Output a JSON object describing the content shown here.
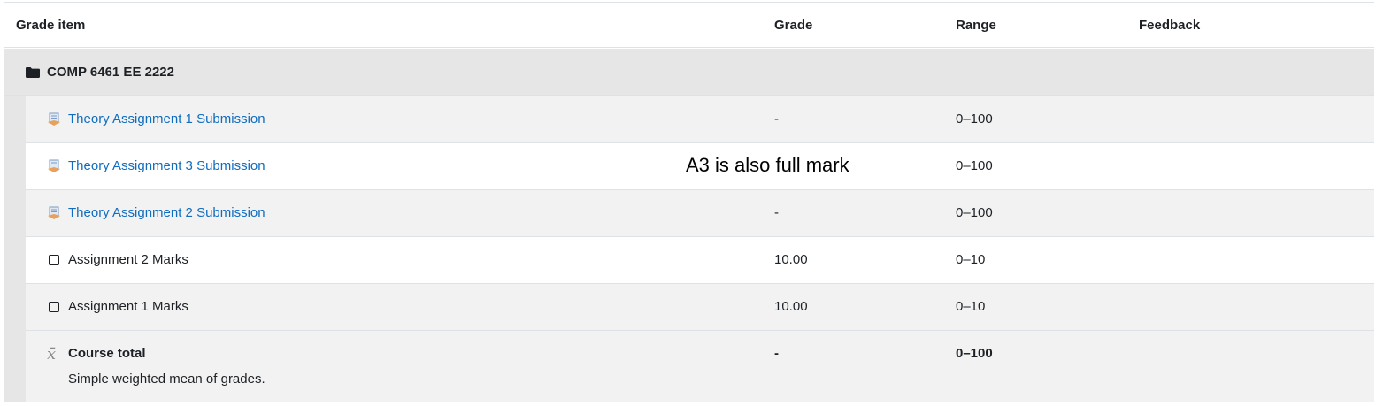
{
  "table": {
    "headers": {
      "grade_item": "Grade item",
      "grade": "Grade",
      "range": "Range",
      "feedback": "Feedback"
    },
    "category": {
      "icon": "folder-icon",
      "label": "COMP 6461 EE 2222"
    },
    "rows": [
      {
        "icon": "assignment-icon",
        "name": "Theory Assignment 1 Submission",
        "link": true,
        "grade": "-",
        "range": "0–100",
        "feedback": ""
      },
      {
        "icon": "assignment-icon",
        "name": "Theory Assignment 3 Submission",
        "link": true,
        "grade": "",
        "range": "0–100",
        "feedback": ""
      },
      {
        "icon": "assignment-icon",
        "name": "Theory Assignment 2 Submission",
        "link": true,
        "grade": "-",
        "range": "0–100",
        "feedback": ""
      },
      {
        "icon": "manual-item-icon",
        "name": "Assignment 2 Marks",
        "link": false,
        "grade": "10.00",
        "range": "0–10",
        "feedback": ""
      },
      {
        "icon": "manual-item-icon",
        "name": "Assignment 1 Marks",
        "link": false,
        "grade": "10.00",
        "range": "0–10",
        "feedback": ""
      }
    ],
    "total": {
      "icon": "mean-icon",
      "name": "Course total",
      "description": "Simple weighted mean of grades.",
      "grade": "-",
      "range": "0–100"
    }
  },
  "annotation": {
    "text": "A3 is also full mark"
  }
}
